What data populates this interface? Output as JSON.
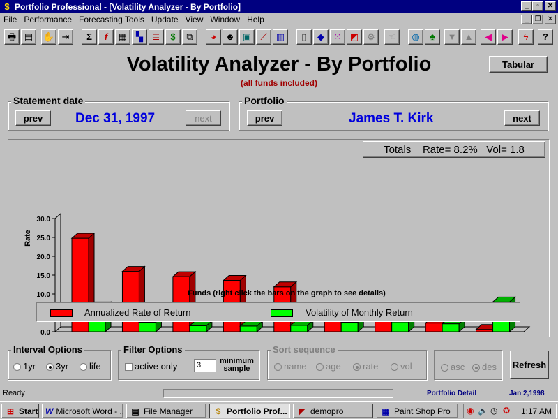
{
  "window": {
    "title": "Portfolio Professional - [Volatility Analyzer - By Portfolio]"
  },
  "menu": {
    "items": [
      "File",
      "Performance",
      "Forecasting Tools",
      "Update",
      "View",
      "Window",
      "Help"
    ]
  },
  "toolbar": {
    "icons": [
      "print-icon",
      "print-preview-icon",
      "stop-hand-icon",
      "import-icon",
      "sigma-icon",
      "function-icon",
      "grid-icon",
      "chart-grid-icon",
      "stack-chart-icon",
      "money-bag-icon",
      "copy-icon",
      "pie-chart-icon",
      "people-icon",
      "notebook-icon",
      "trend-chart-icon",
      "bar-chart-icon",
      "book-icon",
      "shield-icon",
      "color-grid-icon",
      "shapes-icon",
      "disabled-gear-icon",
      "disabled-hand-icon",
      "globe-icon",
      "tree-icon",
      "arrow-down-icon",
      "arrow-up-icon",
      "arrow-left-icon",
      "arrow-right-icon",
      "lightning-icon",
      "help-icon"
    ]
  },
  "main": {
    "title": "Volatility Analyzer - By Portfolio",
    "subtitle": "(all funds included)",
    "tabular_button": "Tabular"
  },
  "statement": {
    "label": "Statement date",
    "prev": "prev",
    "date": "Dec 31, 1997",
    "next": "next"
  },
  "portfolio": {
    "label": "Portfolio",
    "prev": "prev",
    "name": "James T. Kirk",
    "next": "next"
  },
  "totals": {
    "text": "Totals    Rate= 8.2%   Vol= 1.8"
  },
  "chart_data": {
    "type": "bar",
    "ylabel": "Rate",
    "xlabel": "Funds (right click the bars on the graph to see details)",
    "ylim": [
      0,
      30
    ],
    "yticks": [
      "0.0",
      "5.0",
      "10.0",
      "15.0",
      "20.0",
      "25.0",
      "30.0"
    ],
    "categories": [
      "",
      "",
      "",
      "",
      "",
      "",
      "",
      "",
      ""
    ],
    "series": [
      {
        "name": "Annualized Rate of Return",
        "color": "#ff0000",
        "values": [
          24.8,
          16.0,
          14.6,
          13.6,
          11.9,
          5.6,
          2.8,
          2.3,
          0.6
        ]
      },
      {
        "name": "Volatility of Monthly Return",
        "color": "#00ff00",
        "values": [
          6.6,
          2.5,
          1.6,
          1.5,
          1.7,
          2.5,
          2.6,
          2.1,
          7.9
        ]
      }
    ],
    "legend_position": "bottom"
  },
  "interval": {
    "label": "Interval Options",
    "options": [
      "1yr",
      "3yr",
      "life"
    ],
    "selected": "3yr"
  },
  "filter": {
    "label": "Filter Options",
    "active_only": "active only",
    "min_sample_value": "3",
    "min_sample_label_1": "minimum",
    "min_sample_label_2": "sample"
  },
  "sort": {
    "label": "Sort sequence",
    "options": [
      "name",
      "age",
      "rate",
      "vol"
    ],
    "selected": "rate",
    "order": [
      "asc",
      "des"
    ],
    "order_selected": "des"
  },
  "refresh_button": "Refresh",
  "status": {
    "left": "Ready",
    "mode": "Portfolio Detail",
    "date": "Jan 2,1998"
  },
  "taskbar": {
    "start": "Start",
    "tasks": [
      "Microsoft Word - ...",
      "File Manager",
      "Portfolio Prof...",
      "demopro",
      "Paint Shop Pro"
    ],
    "active_task": "Portfolio Prof...",
    "clock": "1:17 AM"
  }
}
